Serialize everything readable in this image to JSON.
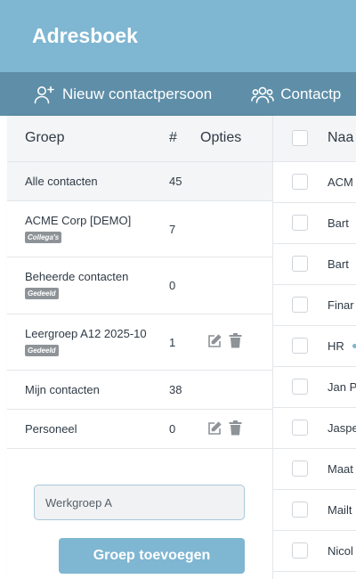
{
  "header": {
    "title": "Adresboek"
  },
  "toolbar": {
    "new_contact_label": "Nieuw contactpersoon",
    "contacts_label": "Contactp"
  },
  "groups_table": {
    "columns": {
      "group": "Groep",
      "count": "#",
      "options": "Opties"
    },
    "rows": [
      {
        "name": "Alle contacten",
        "count": "45",
        "selected": true
      },
      {
        "name": "ACME Corp [DEMO]",
        "badge": "Collega's",
        "count": "7"
      },
      {
        "name": "Beheerde contacten",
        "badge": "Gedeeld",
        "count": "0"
      },
      {
        "name": "Leergroep A12 2025-10",
        "badge": "Gedeeld",
        "count": "1",
        "options": [
          "edit-icon",
          "trash-icon"
        ]
      },
      {
        "name": "Mijn contacten",
        "count": "38"
      },
      {
        "name": "Personeel",
        "count": "0",
        "options": [
          "edit-icon",
          "trash-icon"
        ]
      }
    ]
  },
  "new_group": {
    "input_value": "Werkgroep A",
    "button_label": "Groep toevoegen"
  },
  "contacts_table": {
    "column_name": "Naa",
    "rows": [
      "ACM",
      "Bart",
      "Bart",
      "Finar",
      "HR",
      "Jan P",
      "Jaspe",
      "Maat",
      "Mailt",
      "Nicol"
    ]
  },
  "colors": {
    "header_bg": "#7fb6d2",
    "toolbar_bg": "#5e8ea8",
    "primary_button": "#7fb6d2",
    "badge_bg": "#8e9398"
  }
}
